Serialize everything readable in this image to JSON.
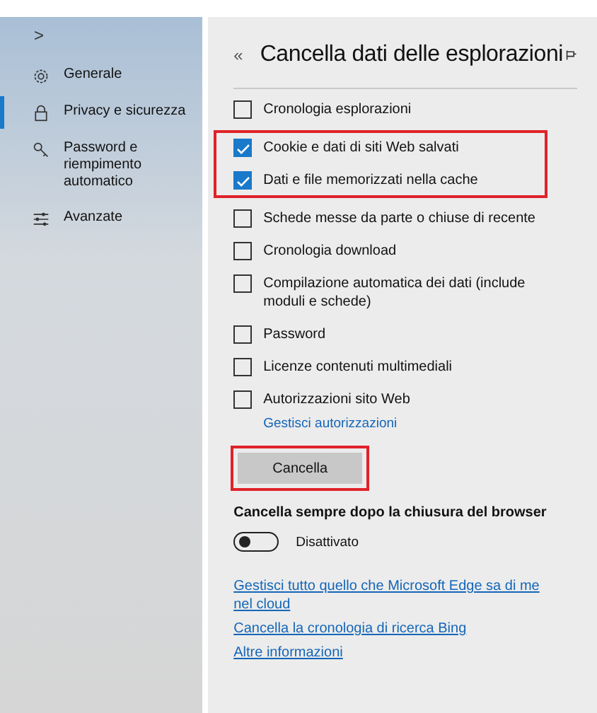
{
  "sidebar": {
    "expand_glyph": ">",
    "items": [
      {
        "label": "Generale",
        "selected": false
      },
      {
        "label": "Privacy e sicurezza",
        "selected": true
      },
      {
        "label": "Password e riempimento automatico",
        "selected": false
      },
      {
        "label": "Avanzate",
        "selected": false
      }
    ]
  },
  "panel": {
    "back_glyph": "«",
    "title": "Cancella dati delle esplorazioni",
    "option_groups": [
      {
        "highlighted": false,
        "options": [
          {
            "label": "Cronologia esplorazioni",
            "checked": false
          }
        ]
      },
      {
        "highlighted": true,
        "options": [
          {
            "label": "Cookie e dati di siti Web salvati",
            "checked": true
          },
          {
            "label": "Dati e file memorizzati nella cache",
            "checked": true
          }
        ]
      },
      {
        "highlighted": false,
        "options": [
          {
            "label": "Schede messe da parte o chiuse di recente",
            "checked": false
          },
          {
            "label": "Cronologia download",
            "checked": false
          },
          {
            "label": "Compilazione automatica dei dati (include moduli e schede)",
            "checked": false
          },
          {
            "label": "Password",
            "checked": false
          },
          {
            "label": "Licenze contenuti multimediali",
            "checked": false
          },
          {
            "label": "Autorizzazioni sito Web",
            "checked": false,
            "link": "Gestisci autorizzazioni"
          }
        ]
      }
    ],
    "button": {
      "label": "Cancella",
      "highlighted": true
    },
    "always_clear": {
      "label": "Cancella sempre dopo la chiusura del browser",
      "on": false,
      "state_text": "Disattivato"
    },
    "links": [
      "Gestisci tutto quello che Microsoft Edge sa di me nel cloud",
      "Cancella la cronologia di ricerca Bing",
      "Altre informazioni"
    ]
  }
}
